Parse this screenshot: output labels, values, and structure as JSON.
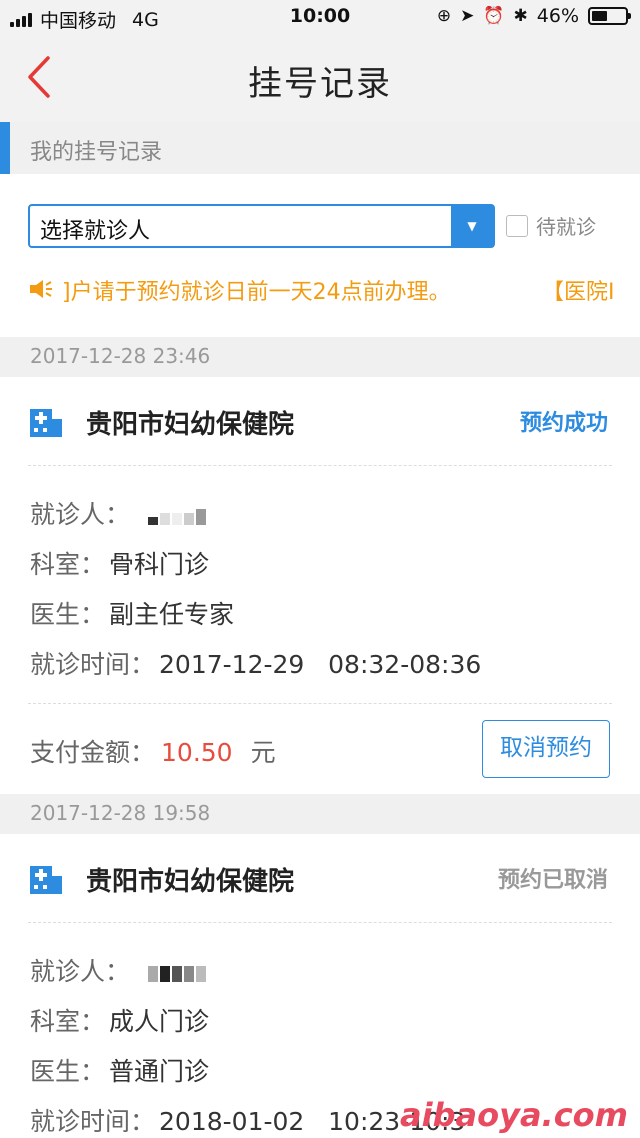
{
  "status_bar": {
    "carrier": "中国移动",
    "network": "4G",
    "time": "10:00",
    "battery": "46%"
  },
  "nav": {
    "title": "挂号记录"
  },
  "section_title": "我的挂号记录",
  "filter": {
    "select_value": "选择就诊人",
    "checkbox_label": "待就诊"
  },
  "notice": {
    "text_main": "]户请于预约就诊日前一天24点前办理。",
    "text_tail": "【医院I"
  },
  "labels": {
    "patient": "就诊人：",
    "department": "科室：",
    "doctor": "医生：",
    "visit_time": "就诊时间：",
    "pay_amount": "支付金额：",
    "unit": "元"
  },
  "records": [
    {
      "created": "2017-12-28 23:46",
      "hospital": "贵阳市妇幼保健院",
      "status": "预约成功",
      "status_color": "#2d8ce0",
      "department": "骨科门诊",
      "doctor": "副主任专家",
      "visit_time": "2017-12-29   08:32-08:36",
      "amount": "10.50",
      "action": "取消预约"
    },
    {
      "created": "2017-12-28 19:58",
      "hospital": "贵阳市妇幼保健院",
      "status": "预约已取消",
      "status_color": "#999999",
      "department": "成人门诊",
      "doctor": "普通门诊",
      "visit_time": "2018-01-02   10:23-10:3"
    }
  ],
  "watermark": "aibaoya.com",
  "colors": {
    "accent": "#2d8ce0",
    "notice": "#f39c12",
    "amount": "#e74c3c"
  }
}
